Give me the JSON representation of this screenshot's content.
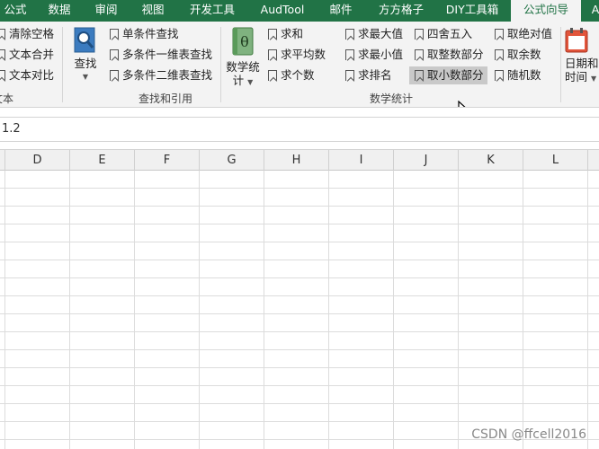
{
  "tabs": [
    {
      "label": "公式",
      "active": false
    },
    {
      "label": "数据",
      "active": false
    },
    {
      "label": "审阅",
      "active": false
    },
    {
      "label": "视图",
      "active": false
    },
    {
      "label": "开发工具",
      "active": false
    },
    {
      "label": "AudTool",
      "active": false
    },
    {
      "label": "邮件",
      "active": false
    },
    {
      "label": "方方格子",
      "active": false
    },
    {
      "label": "DIY工具箱",
      "active": false
    },
    {
      "label": "公式向导",
      "active": true
    },
    {
      "label": "A",
      "active": false
    }
  ],
  "ribbon": {
    "text_group": {
      "label": "文本",
      "items": [
        "清除空格",
        "文本合并",
        "文本对比"
      ]
    },
    "lookup_group": {
      "label": "查找和引用",
      "big_button": "查找",
      "items": [
        "单条件查找",
        "多条件一维表查找",
        "多条件二维表查找"
      ]
    },
    "math_group": {
      "label": "数学统计",
      "big_button_line1": "数学统",
      "big_button_line2": "计",
      "col1": [
        "求和",
        "求平均数",
        "求个数"
      ],
      "col2": [
        "求最大值",
        "求最小值",
        "求排名"
      ],
      "col3": [
        "四舍五入",
        "取整数部分",
        "取小数部分"
      ],
      "col4": [
        "取绝对值",
        "取余数",
        "随机数"
      ],
      "hovered_item": "取小数部分"
    },
    "date_group": {
      "big_button_line1": "日期和",
      "big_button_line2": "时间"
    }
  },
  "formula_bar": {
    "value": "1.2"
  },
  "columns": [
    "D",
    "E",
    "F",
    "G",
    "H",
    "I",
    "J",
    "K",
    "L"
  ],
  "watermark": "CSDN @ffcell2016",
  "colors": {
    "tab_bar": "#217346",
    "ribbon": "#f3f3f3",
    "hover": "#c9c9c9"
  }
}
